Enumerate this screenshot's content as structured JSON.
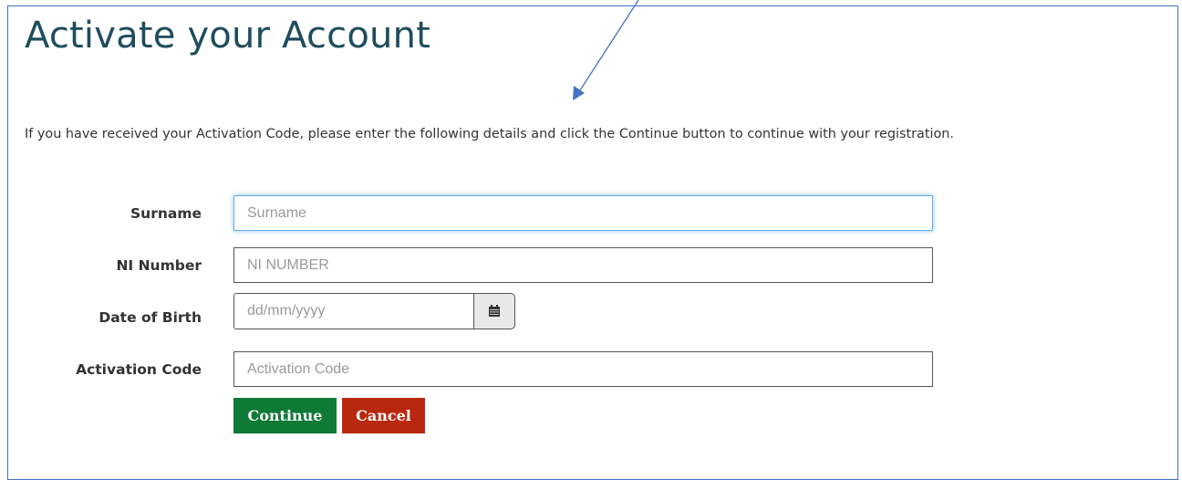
{
  "page": {
    "title": "Activate your Account",
    "intro": "If you have received your Activation Code, please enter the following details and click the Continue button to continue with your registration."
  },
  "form": {
    "surname": {
      "label": "Surname",
      "placeholder": "Surname",
      "value": ""
    },
    "ni_number": {
      "label": "NI Number",
      "placeholder": "NI NUMBER",
      "value": ""
    },
    "date_of_birth": {
      "label": "Date of Birth",
      "placeholder": "dd/mm/yyyy",
      "value": "",
      "icon": "calendar-icon"
    },
    "activation_code": {
      "label": "Activation Code",
      "placeholder": "Activation Code",
      "value": ""
    }
  },
  "actions": {
    "continue_label": "Continue",
    "cancel_label": "Cancel"
  },
  "colors": {
    "frame_border": "#4472c4",
    "title": "#1e4d5e",
    "continue_bg": "#0f7a36",
    "cancel_bg": "#b8280f",
    "focus_border": "#66afe9",
    "annotation_arrow": "#4472c4"
  },
  "annotation": {
    "icon": "arrow-pointer-icon"
  }
}
